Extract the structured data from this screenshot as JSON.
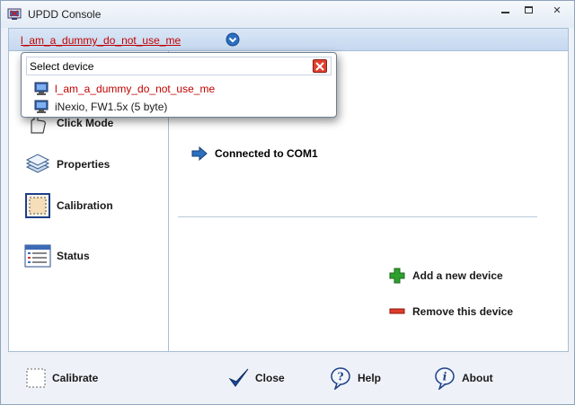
{
  "window": {
    "title": "UPDD Console"
  },
  "device_bar": {
    "current_device": "l_am_a_dummy_do_not_use_me"
  },
  "popup": {
    "title": "Select device",
    "items": [
      {
        "label": "l_am_a_dummy_do_not_use_me",
        "color": "#c00000"
      },
      {
        "label": "iNexio, FW1.5x (5 byte)",
        "color": "#1a1a1a"
      }
    ]
  },
  "nav": {
    "items": [
      {
        "label": "Click Mode",
        "icon": "hand-icon"
      },
      {
        "label": "Properties",
        "icon": "layers-icon"
      },
      {
        "label": "Calibration",
        "icon": "calibration-icon"
      },
      {
        "label": "Status",
        "icon": "status-icon"
      }
    ]
  },
  "main": {
    "connection": "Connected to COM1",
    "add_device": "Add a new device",
    "remove_device": "Remove this device"
  },
  "bottom": {
    "calibrate": "Calibrate",
    "close": "Close",
    "help": "Help",
    "about": "About"
  },
  "colors": {
    "accent_red": "#c00000",
    "add_green": "#2ea02e",
    "remove_red": "#e03a2a",
    "arrow_blue": "#2a6fc0"
  }
}
